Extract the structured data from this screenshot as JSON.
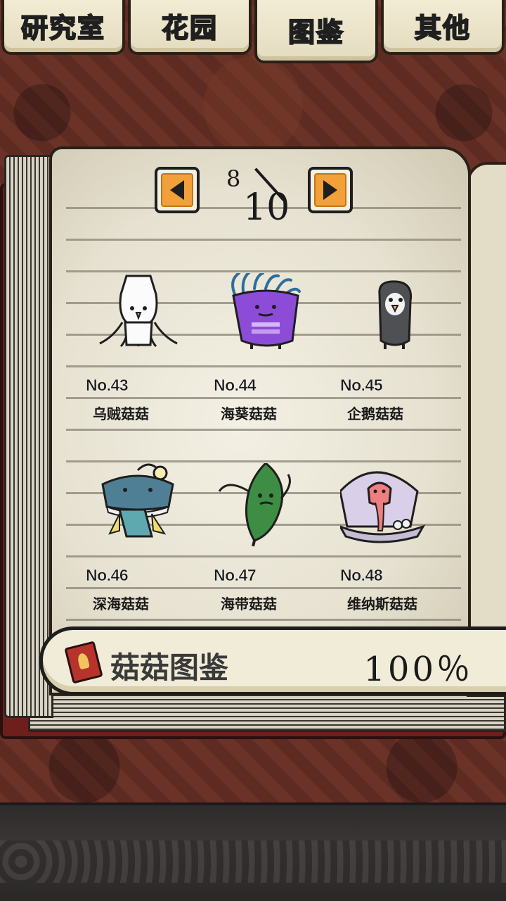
{
  "tabs": [
    {
      "label": "研究室",
      "active": false
    },
    {
      "label": "花园",
      "active": false
    },
    {
      "label": "图鉴",
      "active": true
    },
    {
      "label": "其他",
      "active": false
    }
  ],
  "pager": {
    "current": "8",
    "total": "10"
  },
  "entries": [
    {
      "no": "No.43",
      "name": "乌贼菇菇",
      "icon": "squid-mushroom-icon"
    },
    {
      "no": "No.44",
      "name": "海葵菇菇",
      "icon": "anemone-mushroom-icon"
    },
    {
      "no": "No.45",
      "name": "企鹅菇菇",
      "icon": "penguin-mushroom-icon"
    },
    {
      "no": "No.46",
      "name": "深海菇菇",
      "icon": "anglerfish-mushroom-icon"
    },
    {
      "no": "No.47",
      "name": "海带菇菇",
      "icon": "kelp-mushroom-icon"
    },
    {
      "no": "No.48",
      "name": "维纳斯菇菇",
      "icon": "venus-shell-mushroom-icon"
    }
  ],
  "footer": {
    "title": "菇菇图鉴",
    "percent": "100％",
    "icon": "encyclopedia-book-icon"
  }
}
